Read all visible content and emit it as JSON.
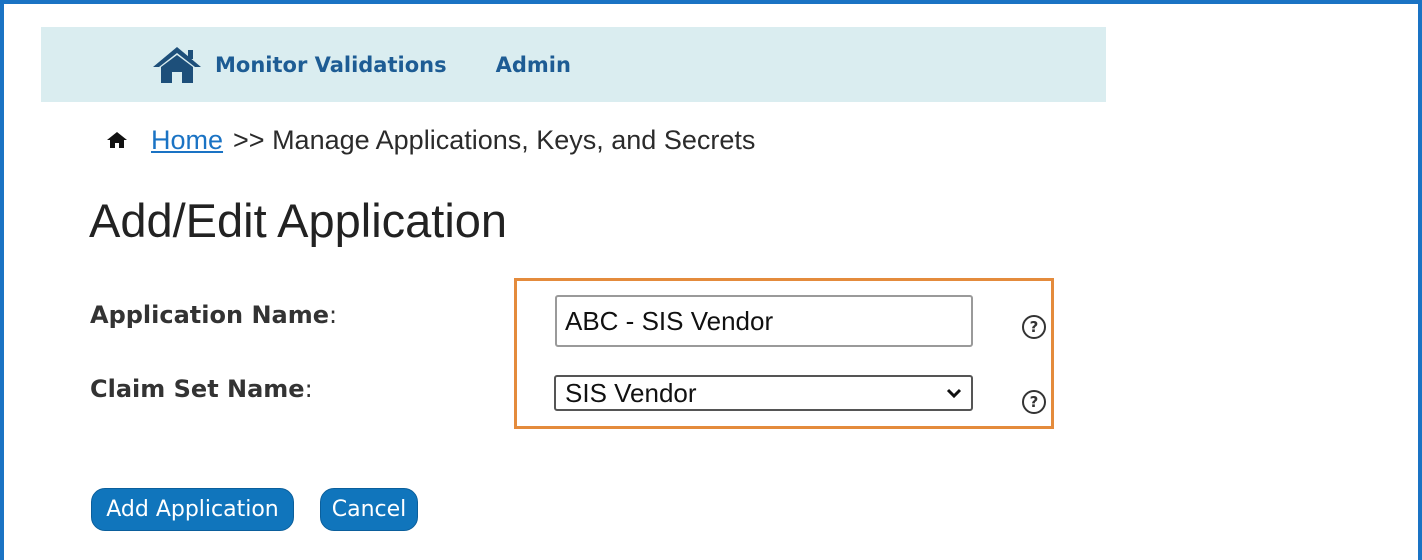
{
  "nav": {
    "home_icon": "home-icon",
    "monitor_label": "Monitor Validations",
    "admin_label": "Admin"
  },
  "breadcrumb": {
    "home_icon": "home-icon",
    "home_label": "Home",
    "rest": ">> Manage Applications, Keys, and Secrets"
  },
  "page": {
    "title": "Add/Edit Application"
  },
  "form": {
    "application_name_label": "Application Name",
    "application_name_value": "ABC - SIS Vendor",
    "claim_set_label": "Claim Set Name",
    "claim_set_value": "SIS Vendor",
    "colon": ":",
    "help_glyph": "?"
  },
  "buttons": {
    "add": "Add Application",
    "cancel": "Cancel"
  },
  "colors": {
    "accent": "#1075bc",
    "nav_background": "#daedf0",
    "highlight": "#e48b3c",
    "frame": "#1a73c4"
  }
}
